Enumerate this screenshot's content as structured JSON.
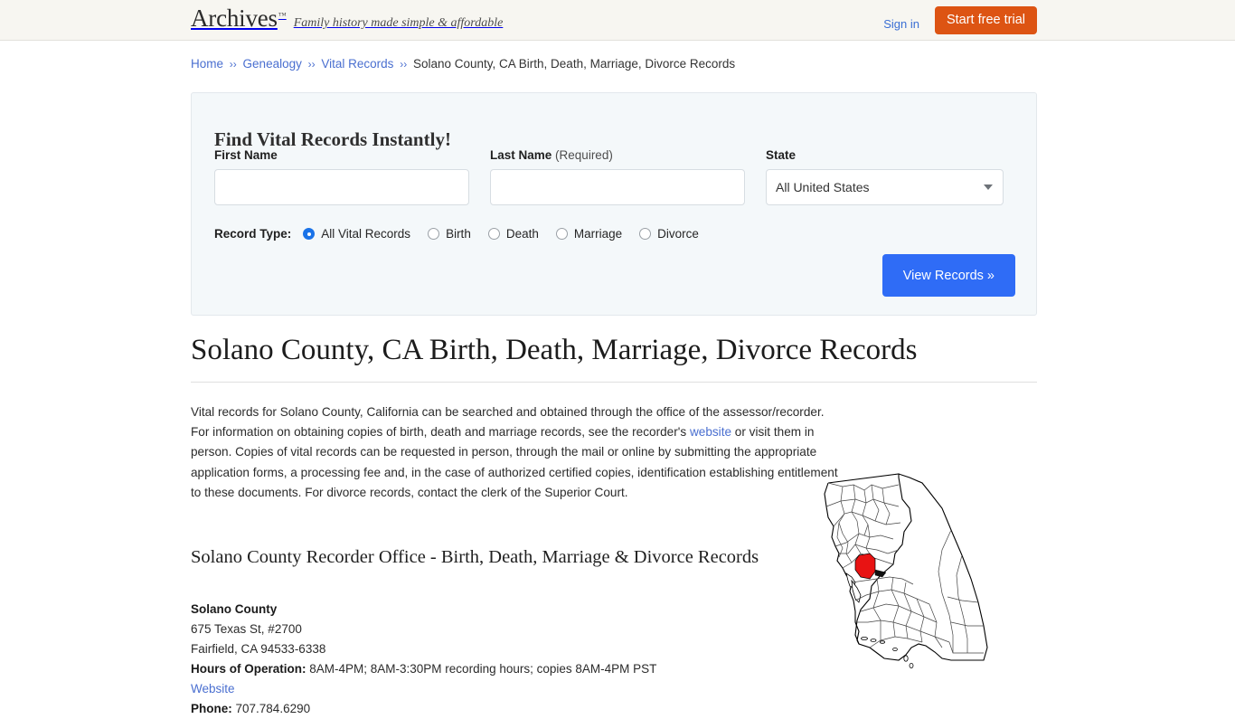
{
  "header": {
    "brand_name": "Archives",
    "brand_tm": "™",
    "tagline": "Family history made simple & affordable",
    "sign_in_label": "Sign in",
    "trial_label": "Start free trial",
    "trial_color": "#dd5413"
  },
  "breadcrumb": {
    "items": [
      {
        "label": "Home",
        "link": true
      },
      {
        "label": "Genealogy",
        "link": true
      },
      {
        "label": "Vital Records",
        "link": true
      },
      {
        "label": "Solano County, CA Birth, Death, Marriage, Divorce Records",
        "link": false
      }
    ],
    "separator": "››"
  },
  "search_form": {
    "title": "Find Vital Records Instantly!",
    "first_name": {
      "label": "First Name",
      "value": "",
      "placeholder": ""
    },
    "last_name": {
      "label": "Last Name",
      "required_note": "(Required)",
      "value": "",
      "placeholder": ""
    },
    "state": {
      "label": "State",
      "value": "All United States",
      "options": [
        "All United States",
        "California"
      ],
      "caret_icon": "chevron-down-icon"
    },
    "record_type": {
      "label": "Record Type:",
      "selected": "All Vital Records",
      "options": [
        "All Vital Records",
        "Birth",
        "Death",
        "Marriage",
        "Divorce"
      ]
    },
    "submit_label": "View Records »",
    "submit_color": "#2f6cf6"
  },
  "article": {
    "title": "Solano County, CA Birth, Death, Marriage, Divorce Records",
    "intro_part1": "Vital records for Solano County, California can be searched and obtained through the office of the assessor/recorder. For information on obtaining copies of birth, death and marriage records, see the recorder's ",
    "intro_link": "website",
    "intro_part2": " or visit them in person. Copies of vital records can be requested in person, through the mail or online by submitting the appropriate application forms, a processing fee and, in the case of authorized certified copies, identification establishing entitlement to these documents. For divorce records, contact the clerk of the Superior Court.",
    "sub_heading": "Solano County Recorder Office - Birth, Death, Marriage & Divorce Records",
    "office": {
      "name": "Solano County",
      "street": "675 Texas St, #2700",
      "city_state_zip": "Fairfield, CA 94533-6338",
      "hours_label": "Hours of Operation:",
      "hours_value": "8AM-4PM; 8AM-3:30PM recording hours; copies 8AM-4PM PST",
      "website_label": "Website",
      "phone_label": "Phone:",
      "phone_value": "707.784.6290"
    },
    "map": {
      "alt": "Map of California with Solano County highlighted",
      "highlight_color": "#e81313",
      "outline_color": "#000000",
      "county_line_color": "#555555",
      "highlighted_county": "Solano County"
    }
  }
}
